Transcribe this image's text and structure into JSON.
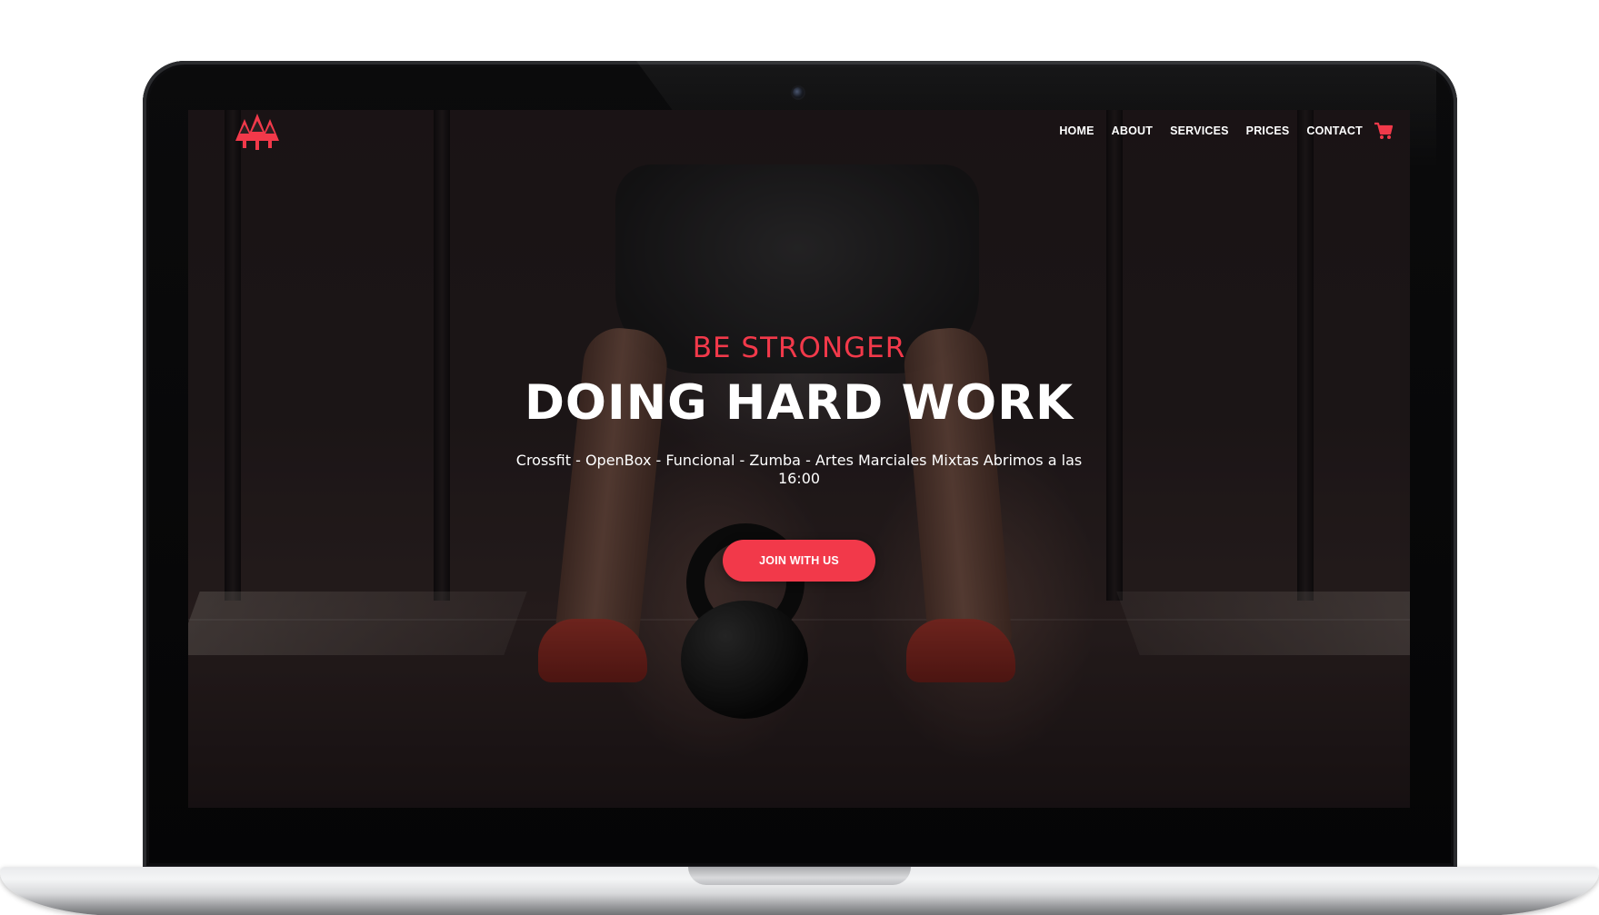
{
  "device": {
    "type": "laptop-mockup",
    "camera_icon": "webcam-icon"
  },
  "site": {
    "logo_icon": "pine-trees-icon",
    "brand_color": "#f2394a",
    "nav": [
      {
        "label": "HOME"
      },
      {
        "label": "ABOUT"
      },
      {
        "label": "SERVICES"
      },
      {
        "label": "PRICES"
      },
      {
        "label": "CONTACT"
      }
    ],
    "cart_icon": "shopping-cart-icon"
  },
  "hero": {
    "tagline": "BE STRONGER",
    "headline": "DOING HARD WORK",
    "subtitle": "Crossfit - OpenBox - Funcional - Zumba - Artes Marciales Mixtas Abrimos a las 16:00",
    "cta_label": "JOIN WITH US",
    "background_image": "athlete-with-kettlebell"
  }
}
